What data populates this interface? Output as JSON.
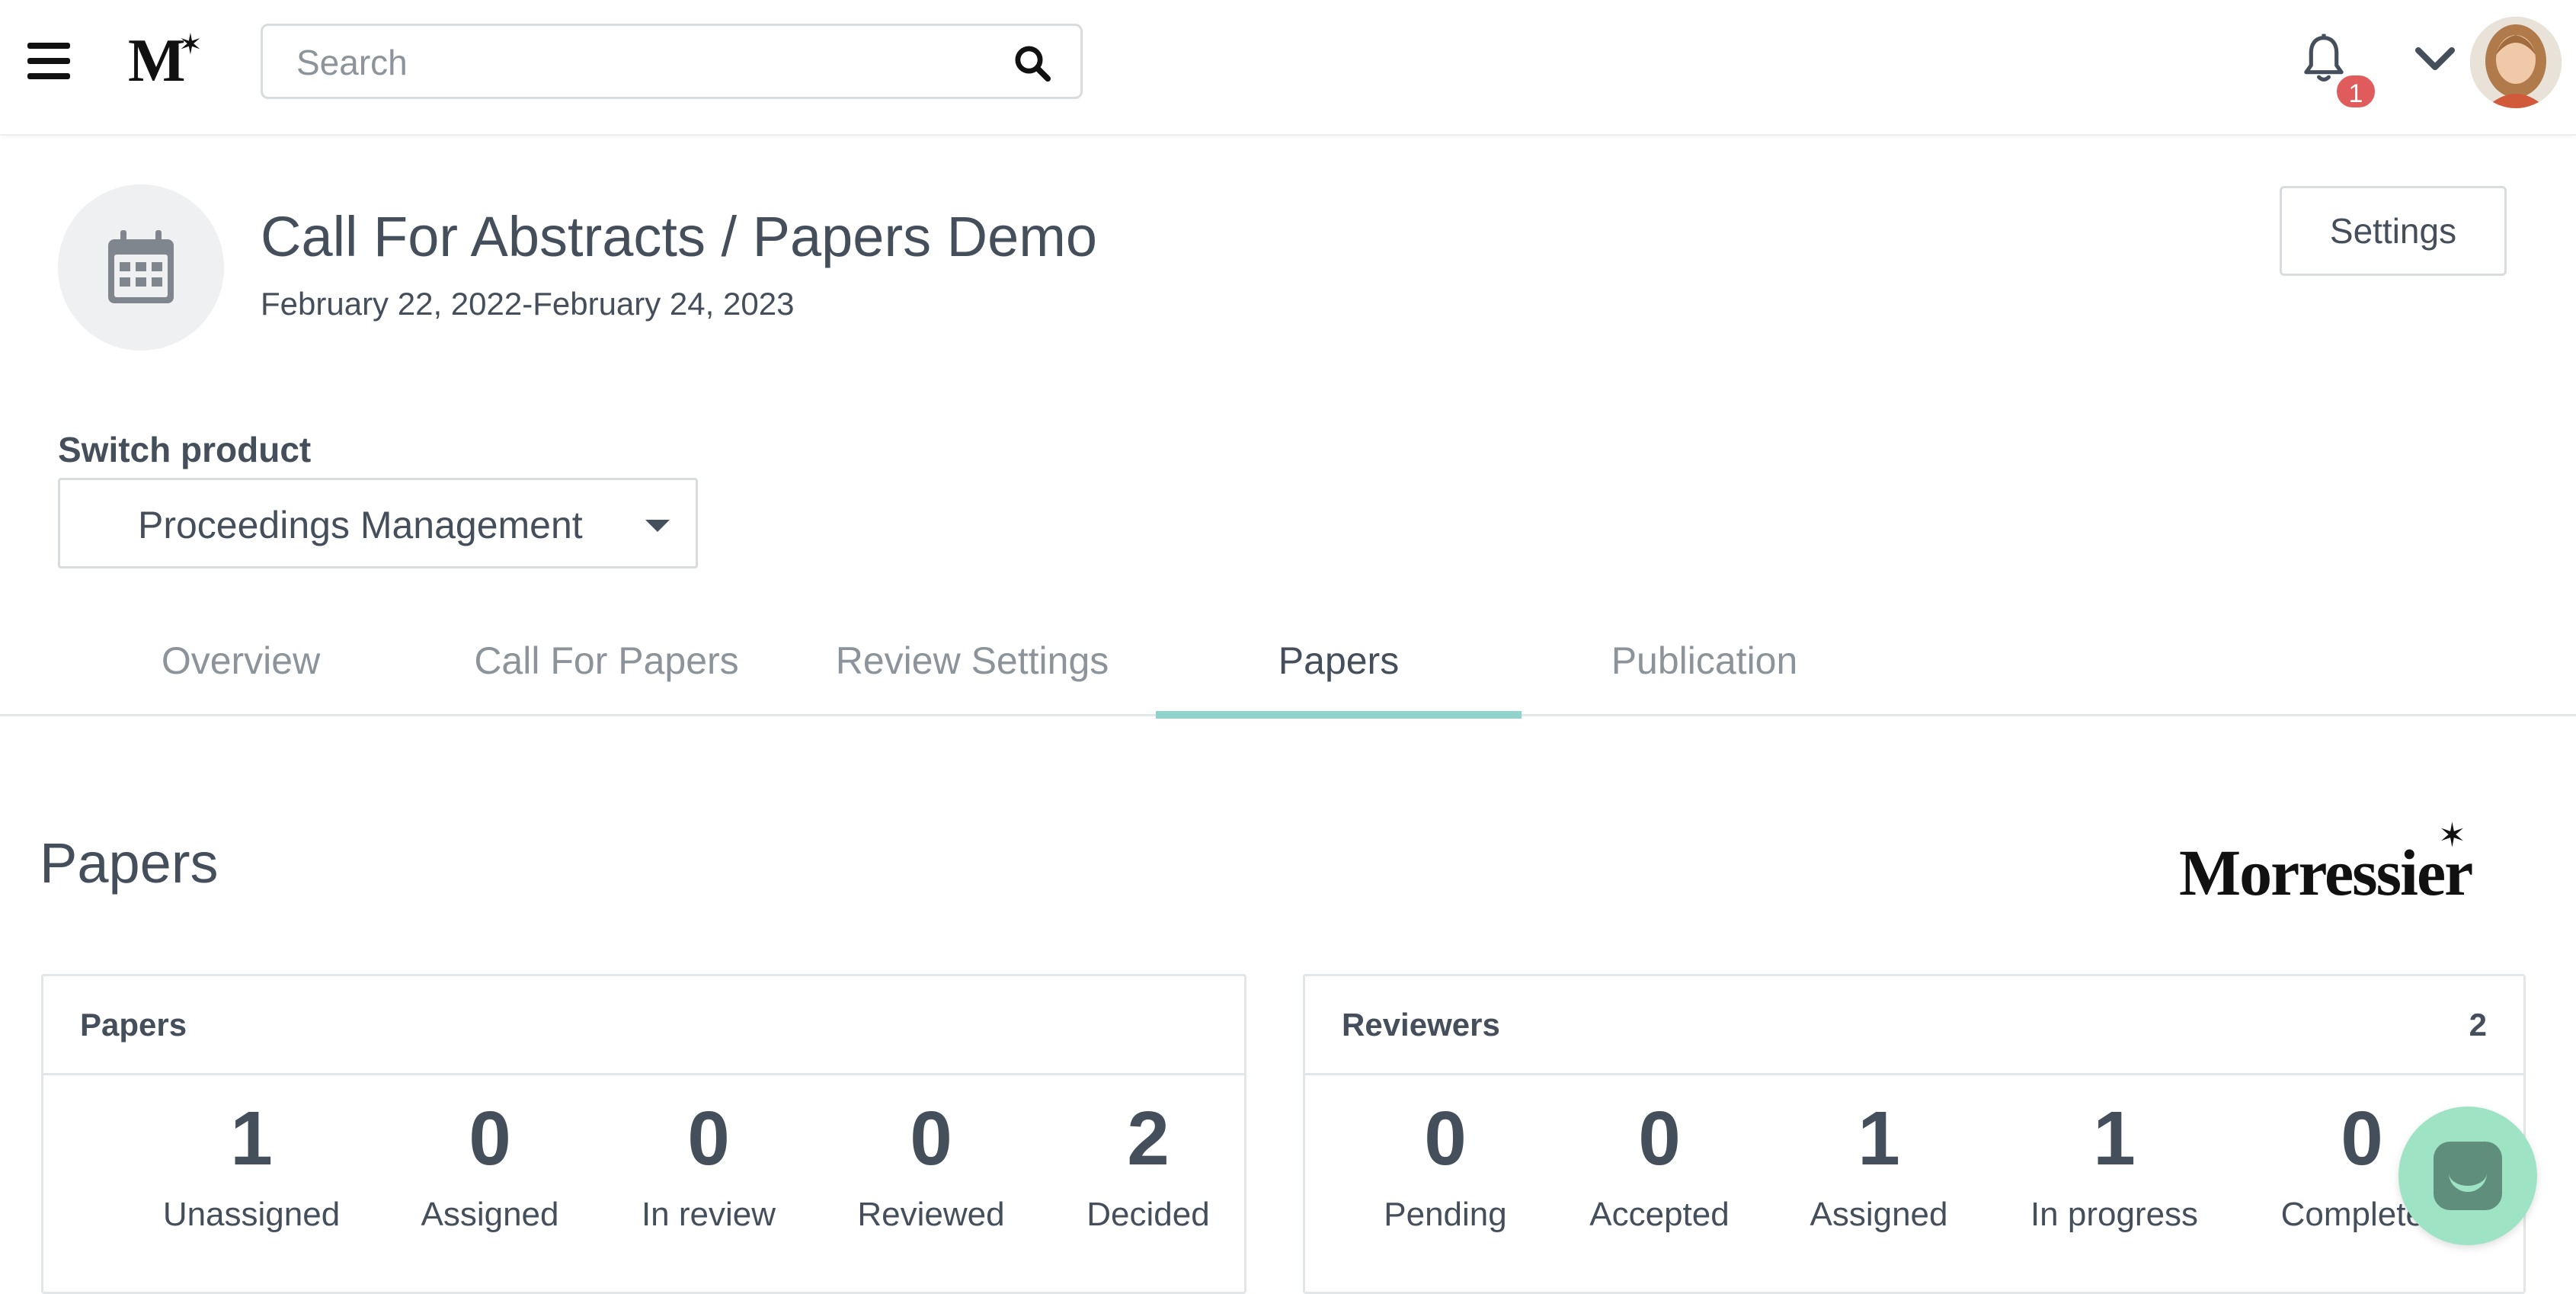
{
  "header": {
    "logo_letter": "M",
    "logo_star": "✶",
    "search_placeholder": "Search",
    "notification_count": "1"
  },
  "event": {
    "title": "Call For Abstracts / Papers Demo",
    "dates": "February 22, 2022-February 24, 2023",
    "settings_label": "Settings"
  },
  "product_switch": {
    "label": "Switch product",
    "selected": "Proceedings Management"
  },
  "tabs": [
    {
      "label": "Overview",
      "active": false
    },
    {
      "label": "Call For Papers",
      "active": false
    },
    {
      "label": "Review Settings",
      "active": false
    },
    {
      "label": "Papers",
      "active": true
    },
    {
      "label": "Publication",
      "active": false
    }
  ],
  "section": {
    "title": "Papers",
    "brand": "Morressier",
    "brand_star": "✶"
  },
  "papers_card": {
    "title": "Papers",
    "stats": [
      {
        "value": "1",
        "label": "Unassigned"
      },
      {
        "value": "0",
        "label": "Assigned"
      },
      {
        "value": "0",
        "label": "In review"
      },
      {
        "value": "0",
        "label": "Reviewed"
      },
      {
        "value": "2",
        "label": "Decided"
      }
    ]
  },
  "reviewers_card": {
    "title": "Reviewers",
    "count": "2",
    "stats": [
      {
        "value": "0",
        "label": "Pending"
      },
      {
        "value": "0",
        "label": "Accepted"
      },
      {
        "value": "1",
        "label": "Assigned"
      },
      {
        "value": "1",
        "label": "In progress"
      },
      {
        "value": "0",
        "label": "Completed"
      }
    ]
  },
  "colors": {
    "text": "#454f5b",
    "muted": "#8c939b",
    "tab_indicator": "#8fd3cc",
    "badge": "#e05c5c",
    "chat": "#9fe3c5"
  }
}
